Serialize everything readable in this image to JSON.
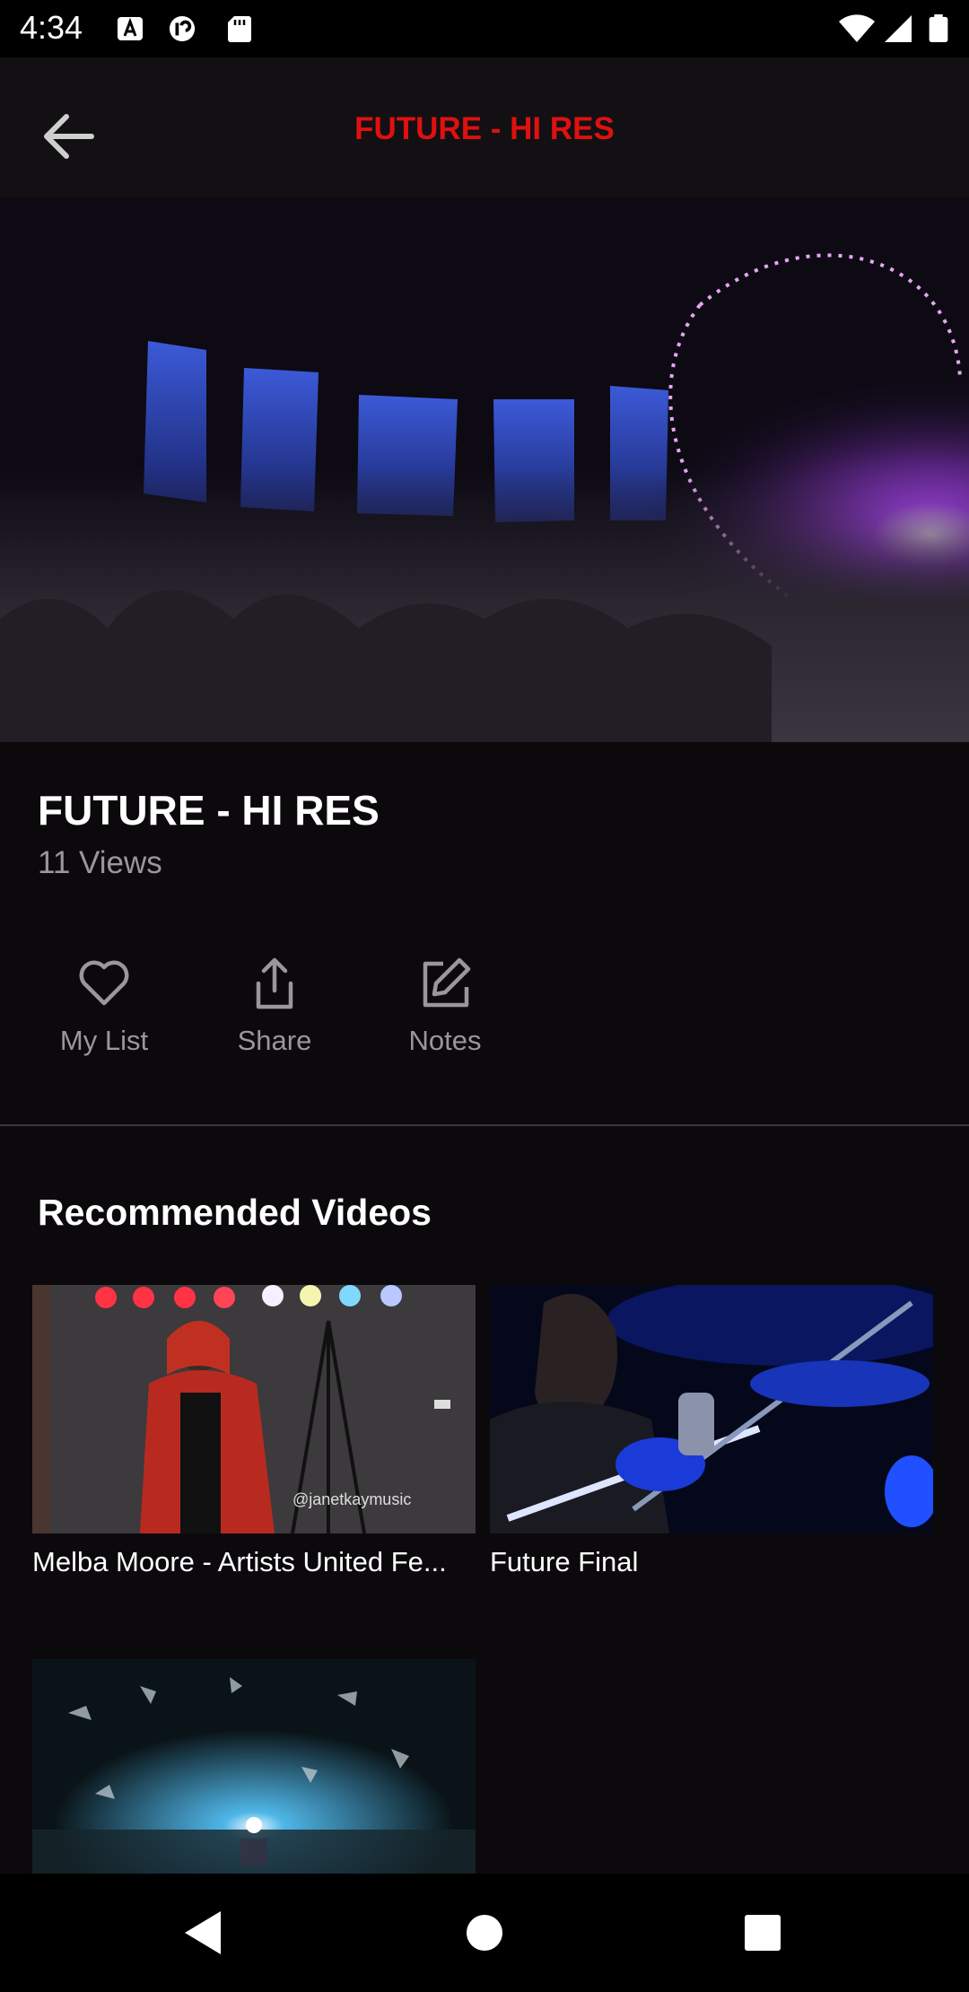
{
  "status_bar": {
    "time": "4:34"
  },
  "app_bar": {
    "title": "FUTURE - HI RES",
    "title_color": "#e01010"
  },
  "video": {
    "title": "FUTURE - HI RES",
    "views": "11 Views"
  },
  "actions": [
    {
      "label": "My List",
      "icon": "heart-icon"
    },
    {
      "label": "Share",
      "icon": "share-icon"
    },
    {
      "label": "Notes",
      "icon": "edit-icon"
    }
  ],
  "recommended": {
    "title": "Recommended Videos",
    "items": [
      {
        "title": "Melba Moore - Artists United Fe...",
        "watermark": "@janetkaymusic"
      },
      {
        "title": "Future Final"
      },
      {
        "title": ""
      }
    ]
  }
}
